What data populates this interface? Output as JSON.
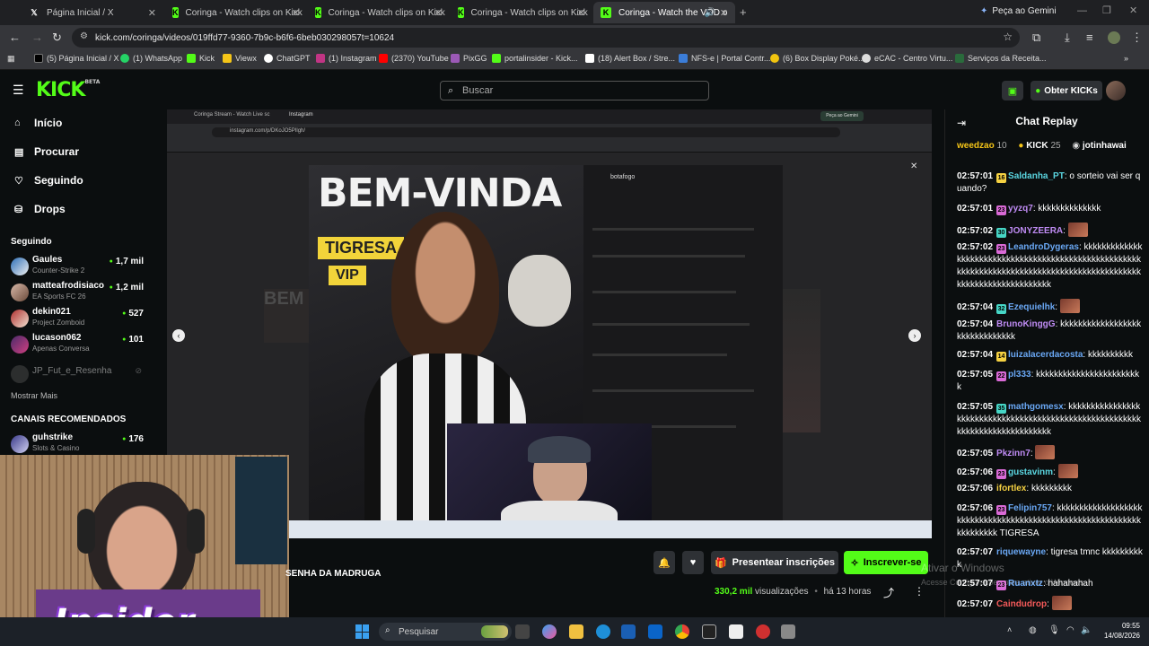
{
  "browser": {
    "tabs": [
      {
        "label": "Página Inicial / X",
        "icon": "x-icon"
      },
      {
        "label": "Coringa - Watch clips on Kick",
        "icon": "kick-icon"
      },
      {
        "label": "Coringa - Watch clips on Kick",
        "icon": "kick-icon"
      },
      {
        "label": "Coringa - Watch clips on Kick",
        "icon": "kick-icon"
      },
      {
        "label": "Coringa - Watch the VOD o",
        "icon": "kick-icon"
      }
    ],
    "gemini_label": "Peça ao Gemini",
    "url": "kick.com/coringa/videos/019ffd77-9360-7b9c-b6f6-6beb030298057t=10624",
    "bookmarks": [
      "(5) Página Inicial / X",
      "(1) WhatsApp",
      "Kick",
      "Viewx",
      "ChatGPT",
      "(1) Instagram",
      "(2370) YouTube",
      "PixGG",
      "portalinsider - Kick...",
      "(18) Alert Box / Stre...",
      "NFS-e | Portal Contr...",
      "(6) Box Display Poké...",
      "eCAC - Centro Virtu...",
      "Serviços da Receita..."
    ]
  },
  "kick": {
    "logo": "KICK",
    "logo_beta": "BETA",
    "search_placeholder": "Buscar",
    "get_kicks": "Obter KICKs",
    "nav": [
      {
        "label": "Início",
        "icon": "home-icon"
      },
      {
        "label": "Procurar",
        "icon": "browse-icon"
      },
      {
        "label": "Seguindo",
        "icon": "heart-icon"
      },
      {
        "label": "Drops",
        "icon": "drops-icon"
      }
    ],
    "following_title": "Seguindo",
    "following": [
      {
        "name": "Gaules",
        "game": "Counter-Strike 2",
        "viewers": "1,7 mil"
      },
      {
        "name": "matteafrodisiaco",
        "game": "EA Sports FC 26",
        "viewers": "1,2 mil"
      },
      {
        "name": "dekin021",
        "game": "Project Zomboid",
        "viewers": "527"
      },
      {
        "name": "lucason062",
        "game": "Apenas Conversa",
        "viewers": "101"
      },
      {
        "name": "JP_Fut_e_Resenha",
        "game": "",
        "viewers": ""
      }
    ],
    "show_more": "Mostrar Mais",
    "recommended_title": "CANAIS RECOMENDADOS",
    "recommended": [
      {
        "name": "guhstrike",
        "game": "Slots & Casino",
        "viewers": "176"
      }
    ],
    "stream_title": "SENHA DA MADRUGA",
    "gift_label": "Presentear inscrições",
    "subscribe_label": "Inscrever-se",
    "views_count": "330,2 mil",
    "views_label": "visualizações",
    "time_ago": "há 13 horas",
    "video": {
      "inner_url": "instagram.com/p/DKoJO5PIlgh/",
      "headline": "BEM-VINDA",
      "tag1": "TIGRESA",
      "tag2": "VIP",
      "account": "botafogo",
      "inner_tab1": "Coringa Stream - Watch Live sc",
      "inner_tab2": "Instagram",
      "inner_gemini": "Peça ao Gemini"
    },
    "webcam_overlay": "Insider"
  },
  "chat": {
    "title": "Chat Replay",
    "top_gifters": [
      {
        "name": "weedzao",
        "count": "10"
      },
      {
        "name": "KICK",
        "count": "25"
      },
      {
        "name": "jotinhawai",
        "count": ""
      }
    ],
    "messages": [
      {
        "time": "02:57:01",
        "user": "Saldanha_PT",
        "badge": "16",
        "badge_color": "#f5d142",
        "color": "#5ad5e0",
        "text": "o sorteio vai ser quando?"
      },
      {
        "time": "02:57:01",
        "user": "yyzq7",
        "badge": "23",
        "badge_color": "#d96ad6",
        "color": "#c08cf5",
        "text": "kkkkkkkkkkkkkk"
      },
      {
        "time": "02:57:02",
        "user": "JONYZEERA",
        "badge": "30",
        "badge_color": "#46d6c6",
        "color": "#c08cf5",
        "text": ""
      },
      {
        "time": "02:57:02",
        "user": "LeandroDygeras",
        "badge": "23",
        "badge_color": "#d96ad6",
        "color": "#6aa8f5",
        "text": "kkkkkkkkkkkkkkkkkkkkkkkkkkkkkkkkkkkkkkkkkkkkkkkkkkkkkkkkkkkkkkkkkkkkkkkkkkkkkkkkkkkkkkkkkkkkkkkkkkkkkkkkkkkkkkkkkkkk"
      },
      {
        "time": "02:57:04",
        "user": "Ezequielhk",
        "badge": "32",
        "badge_color": "#46d6c6",
        "color": "#6aa8f5",
        "text": ""
      },
      {
        "time": "02:57:04",
        "user": "BrunoKinggG",
        "badge": "",
        "badge_color": "",
        "color": "#c08cf5",
        "text": "kkkkkkkkkkkkkkkkkkkkkkkkkkkkkkk"
      },
      {
        "time": "02:57:04",
        "user": "luizalacerdacosta",
        "badge": "14",
        "badge_color": "#f5d142",
        "color": "#6aa8f5",
        "text": "kkkkkkkkkk"
      },
      {
        "time": "02:57:05",
        "user": "pl333",
        "badge": "22",
        "badge_color": "#d96ad6",
        "color": "#6aa8f5",
        "text": "kkkkkkkkkkkkkkkkkkkkkkkk"
      },
      {
        "time": "02:57:05",
        "user": "mathgomesx",
        "badge": "35",
        "badge_color": "#46d6c6",
        "color": "#6aa8f5",
        "text": "kkkkkkkkkkkkkkkkkkkkkkkkkkkkkkkkkkkkkkkkkkkkkkkkkkkkkkkkkkkkkkkkkkkkkkkkkkkkkk"
      },
      {
        "time": "02:57:05",
        "user": "Pkzinn7",
        "badge": "",
        "badge_color": "",
        "color": "#c08cf5",
        "text": ""
      },
      {
        "time": "02:57:06",
        "user": "gustavinm",
        "badge": "23",
        "badge_color": "#d96ad6",
        "color": "#5ad5e0",
        "text": ""
      },
      {
        "time": "02:57:06",
        "user": "ifortlex",
        "badge": "",
        "badge_color": "",
        "color": "#f5d142",
        "text": "kkkkkkkkk"
      },
      {
        "time": "02:57:06",
        "user": "Felipin757",
        "badge": "23",
        "badge_color": "#d96ad6",
        "color": "#6aa8f5",
        "text": "kkkkkkkkkkkkkkkkkkkkkkkkkkkkkkkkkkkkkkkkkkkkkkkkkkkkkkkkkkkkkkkkkkkkk TIGRESA"
      },
      {
        "time": "02:57:07",
        "user": "riquewayne",
        "badge": "",
        "badge_color": "",
        "color": "#6aa8f5",
        "text": "tigresa tmnc kkkkkkkkkk"
      },
      {
        "time": "02:57:07",
        "user": "Ruanxtz",
        "badge": "23",
        "badge_color": "#d96ad6",
        "color": "#6aa8f5",
        "text": "hahahahah"
      },
      {
        "time": "02:57:07",
        "user": "Caindudrop",
        "badge": "",
        "badge_color": "",
        "color": "#f55a5a",
        "text": ""
      }
    ]
  },
  "watermark": {
    "line1": "Ativar o Windows",
    "line2": "Acesse Configurações para ativar o Windows."
  },
  "taskbar": {
    "search_placeholder": "Pesquisar",
    "time": "09:55",
    "date": "14/08/2026"
  },
  "colors": {
    "kick_green": "#53fc18",
    "bg": "#0b0e0f",
    "chrome_bg": "#35363a"
  }
}
